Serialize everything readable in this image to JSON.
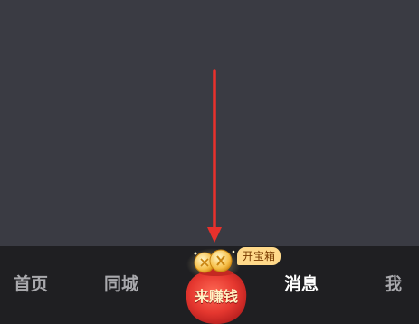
{
  "tabbar": {
    "items": [
      {
        "label": "首页"
      },
      {
        "label": "同城"
      },
      {
        "label": "消息"
      },
      {
        "label": "我"
      }
    ],
    "center": {
      "label": "来赚钱",
      "badge": "开宝箱"
    }
  },
  "colors": {
    "background": "#3a3b43",
    "tabbar": "#1f1f22",
    "arrow": "#e8312c",
    "bag": "#e5372f",
    "badge": "#ffd98a"
  },
  "icons": {
    "pointer": "arrow-down-icon",
    "center": "money-bag-icon"
  }
}
